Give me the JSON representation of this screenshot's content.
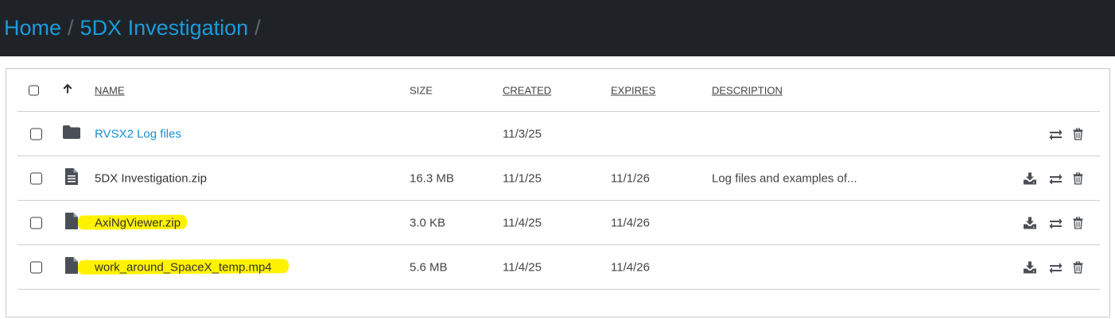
{
  "breadcrumb": {
    "items": [
      "Home",
      "5DX Investigation"
    ],
    "separator": "/"
  },
  "table": {
    "columns": {
      "name": "NAME",
      "size": "SIZE",
      "created": "CREATED",
      "expires": "EXPIRES",
      "description": "DESCRIPTION"
    },
    "sort_icon": "arrow-up-icon",
    "rows": [
      {
        "type": "folder",
        "icon": "folder-icon",
        "name": "RVSX2 Log files",
        "size": "",
        "created": "11/3/25",
        "expires": "",
        "description": "",
        "actions": [
          "move-icon",
          "trash-icon"
        ]
      },
      {
        "type": "file",
        "icon": "document-icon",
        "name": "5DX Investigation.zip",
        "size": "16.3 MB",
        "created": "11/1/25",
        "expires": "11/1/26",
        "description": "Log files and examples of...",
        "actions": [
          "download-icon",
          "move-icon",
          "trash-icon"
        ]
      },
      {
        "type": "file",
        "icon": "file-icon",
        "name": "AxiNgViewer.zip",
        "size": "3.0 KB",
        "created": "11/4/25",
        "expires": "11/4/26",
        "description": "",
        "highlighted": true,
        "actions": [
          "download-icon",
          "move-icon",
          "trash-icon"
        ]
      },
      {
        "type": "file",
        "icon": "file-icon",
        "name": "work_around_SpaceX_temp.mp4",
        "size": "5.6 MB",
        "created": "11/4/25",
        "expires": "11/4/26",
        "description": "",
        "highlighted": true,
        "actions": [
          "download-icon",
          "move-icon",
          "trash-icon"
        ]
      }
    ]
  },
  "colors": {
    "topbar": "#1f2328",
    "link": "#1a9bdb",
    "highlight": "#fff200",
    "icon": "#4a4f55"
  }
}
